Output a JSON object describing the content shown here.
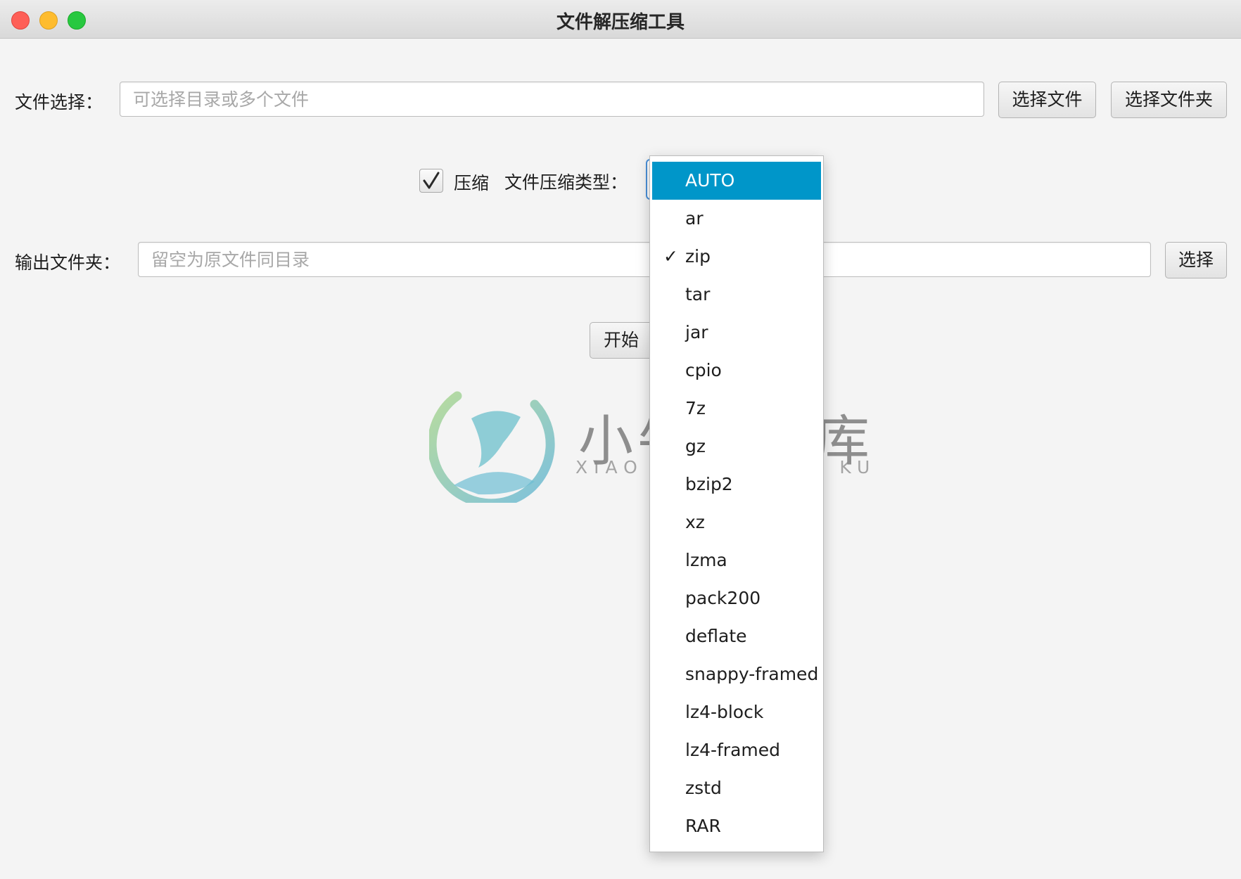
{
  "window": {
    "title": "文件解压缩工具"
  },
  "file_select": {
    "label": "文件选择：",
    "placeholder": "可选择目录或多个文件",
    "select_files_button": "选择文件",
    "select_folder_button": "选择文件夹"
  },
  "compress": {
    "checkbox_label": "压缩",
    "checked": true,
    "type_label": "文件压缩类型："
  },
  "output": {
    "label": "输出文件夹：",
    "placeholder": "留空为原文件同目录",
    "choose_button": "选择"
  },
  "start_button": "开始",
  "watermark": {
    "title": "小牛知识库",
    "subtitle": "XIAO NIU ZHI SHI KU"
  },
  "dropdown": {
    "highlighted": "AUTO",
    "checked": "zip",
    "items": [
      "AUTO",
      "ar",
      "zip",
      "tar",
      "jar",
      "cpio",
      "7z",
      "gz",
      "bzip2",
      "xz",
      "lzma",
      "pack200",
      "deflate",
      "snappy-framed",
      "lz4-block",
      "lz4-framed",
      "zstd",
      "RAR"
    ]
  },
  "colors": {
    "highlight": "#0096c9",
    "background": "#f4f4f4",
    "traffic_close": "#fe5f57",
    "traffic_minimize": "#febc2e",
    "traffic_maximize": "#28c840"
  }
}
